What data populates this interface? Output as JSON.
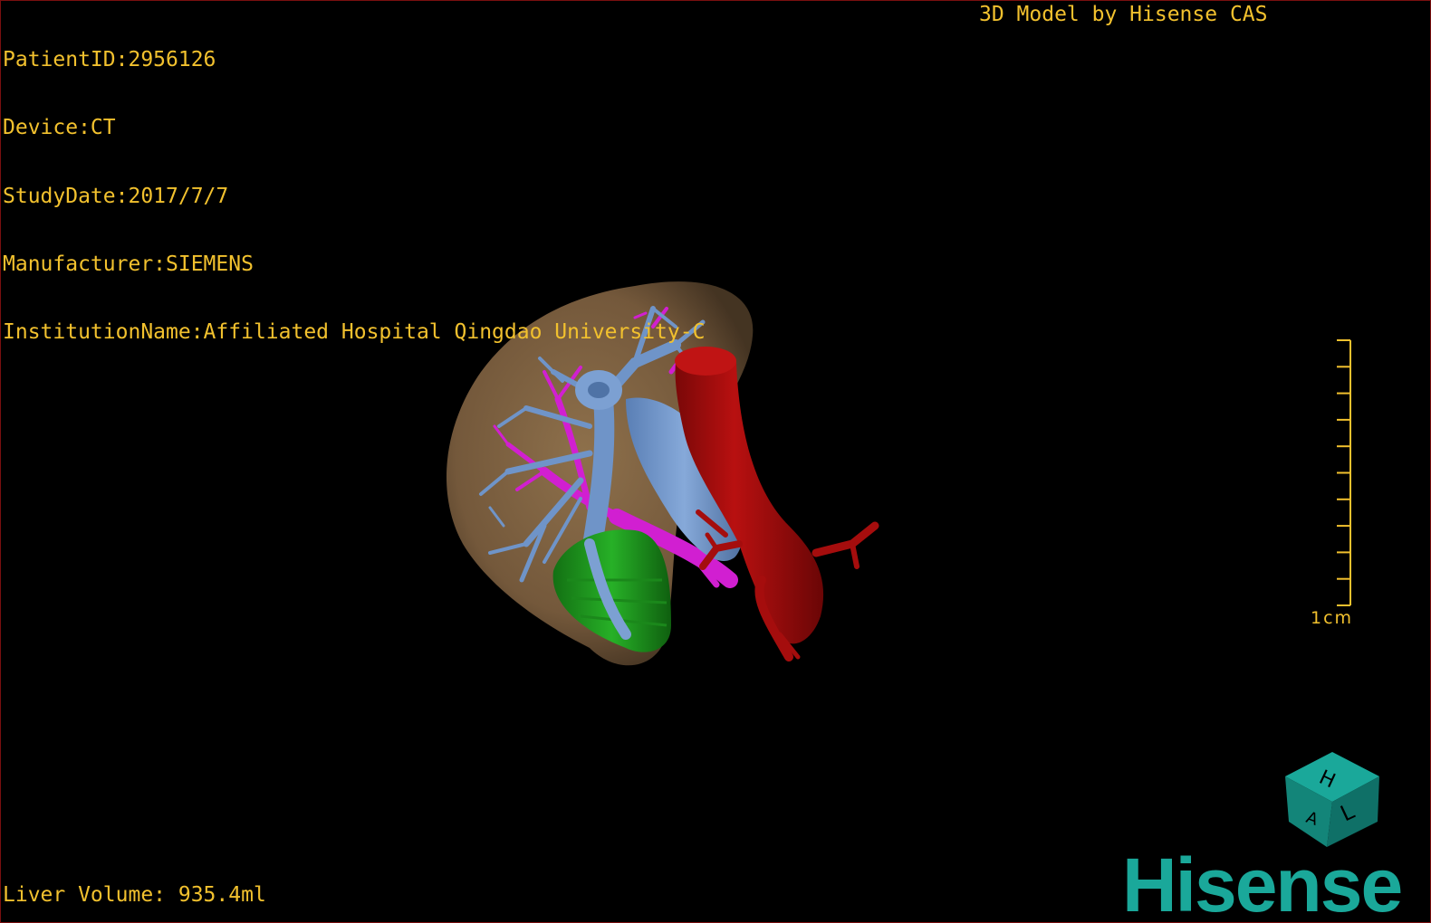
{
  "patient_info": {
    "patient_id": "PatientID:2956126",
    "device": "Device:CT",
    "study_date": "StudyDate:2017/7/7",
    "manufacturer": "Manufacturer:SIEMENS",
    "institution": "InstitutionName:Affiliated Hospital Qingdao University-C"
  },
  "header_right": "3D Model by Hisense CAS",
  "scale_bar": {
    "label": "1cm",
    "tick_count": 10
  },
  "liver_volume": "Liver Volume: 935.4ml",
  "brand": "Hisense",
  "orientation_cube": {
    "visible_letters": [
      "H",
      "L",
      "A"
    ]
  },
  "colors": {
    "hud_text": "#f2c12e",
    "liver": "#8a6a45",
    "portal_vein": "#6f94c8",
    "hepatic_artery": "#d11fd1",
    "ivc_aorta": "#a50d0d",
    "gallbladder_duodenum": "#1f9a1f",
    "brand": "#1aa89a",
    "frame_border": "#7a0f0f"
  }
}
